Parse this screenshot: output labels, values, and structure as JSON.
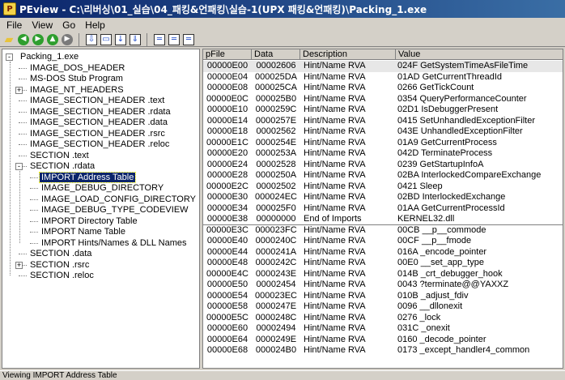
{
  "window": {
    "title": "PEview - C:\\리버싱\\01_실습\\04_패킹&언패킹\\실습-1(UPX 패킹&언패킹)\\Packing_1.exe"
  },
  "menu": [
    "File",
    "View",
    "Go",
    "Help"
  ],
  "tree": [
    {
      "label": "Packing_1.exe",
      "level": 0,
      "expander": "-"
    },
    {
      "label": "IMAGE_DOS_HEADER",
      "level": 1
    },
    {
      "label": "MS-DOS Stub Program",
      "level": 1
    },
    {
      "label": "IMAGE_NT_HEADERS",
      "level": 1,
      "expander": "+"
    },
    {
      "label": "IMAGE_SECTION_HEADER .text",
      "level": 1
    },
    {
      "label": "IMAGE_SECTION_HEADER .rdata",
      "level": 1
    },
    {
      "label": "IMAGE_SECTION_HEADER .data",
      "level": 1
    },
    {
      "label": "IMAGE_SECTION_HEADER .rsrc",
      "level": 1
    },
    {
      "label": "IMAGE_SECTION_HEADER .reloc",
      "level": 1
    },
    {
      "label": "SECTION .text",
      "level": 1
    },
    {
      "label": "SECTION .rdata",
      "level": 1,
      "expander": "-"
    },
    {
      "label": "IMPORT Address Table",
      "level": 2,
      "selected": true
    },
    {
      "label": "IMAGE_DEBUG_DIRECTORY",
      "level": 2
    },
    {
      "label": "IMAGE_LOAD_CONFIG_DIRECTORY",
      "level": 2
    },
    {
      "label": "IMAGE_DEBUG_TYPE_CODEVIEW",
      "level": 2
    },
    {
      "label": "IMPORT Directory Table",
      "level": 2
    },
    {
      "label": "IMPORT Name Table",
      "level": 2
    },
    {
      "label": "IMPORT Hints/Names & DLL Names",
      "level": 2
    },
    {
      "label": "SECTION .data",
      "level": 1
    },
    {
      "label": "SECTION .rsrc",
      "level": 1,
      "expander": "+"
    },
    {
      "label": "SECTION .reloc",
      "level": 1
    }
  ],
  "columns": [
    "pFile",
    "Data",
    "Description",
    "Value"
  ],
  "rows": [
    [
      "00000E00",
      "00002606",
      "Hint/Name RVA",
      "024F  GetSystemTimeAsFileTime"
    ],
    [
      "00000E04",
      "000025DA",
      "Hint/Name RVA",
      "01AD  GetCurrentThreadId"
    ],
    [
      "00000E08",
      "000025CA",
      "Hint/Name RVA",
      "0266  GetTickCount"
    ],
    [
      "00000E0C",
      "000025B0",
      "Hint/Name RVA",
      "0354  QueryPerformanceCounter"
    ],
    [
      "00000E10",
      "0000259C",
      "Hint/Name RVA",
      "02D1  IsDebuggerPresent"
    ],
    [
      "00000E14",
      "0000257E",
      "Hint/Name RVA",
      "0415  SetUnhandledExceptionFilter"
    ],
    [
      "00000E18",
      "00002562",
      "Hint/Name RVA",
      "043E  UnhandledExceptionFilter"
    ],
    [
      "00000E1C",
      "0000254E",
      "Hint/Name RVA",
      "01A9  GetCurrentProcess"
    ],
    [
      "00000E20",
      "0000253A",
      "Hint/Name RVA",
      "042D  TerminateProcess"
    ],
    [
      "00000E24",
      "00002528",
      "Hint/Name RVA",
      "0239  GetStartupInfoA"
    ],
    [
      "00000E28",
      "0000250A",
      "Hint/Name RVA",
      "02BA  InterlockedCompareExchange"
    ],
    [
      "00000E2C",
      "00002502",
      "Hint/Name RVA",
      "0421  Sleep"
    ],
    [
      "00000E30",
      "000024EC",
      "Hint/Name RVA",
      "02BD  InterlockedExchange"
    ],
    [
      "00000E34",
      "000025F0",
      "Hint/Name RVA",
      "01AA  GetCurrentProcessId"
    ],
    [
      "00000E38",
      "00000000",
      "End of Imports",
      "KERNEL32.dll"
    ],
    [
      "00000E3C",
      "000023FC",
      "Hint/Name RVA",
      "00CB  __p__commode"
    ],
    [
      "00000E40",
      "0000240C",
      "Hint/Name RVA",
      "00CF  __p__fmode"
    ],
    [
      "00000E44",
      "0000241A",
      "Hint/Name RVA",
      "016A  _encode_pointer"
    ],
    [
      "00000E48",
      "0000242C",
      "Hint/Name RVA",
      "00E0  __set_app_type"
    ],
    [
      "00000E4C",
      "0000243E",
      "Hint/Name RVA",
      "014B  _crt_debugger_hook"
    ],
    [
      "00000E50",
      "00002454",
      "Hint/Name RVA",
      "0043  ?terminate@@YAXXZ"
    ],
    [
      "00000E54",
      "000023EC",
      "Hint/Name RVA",
      "010B  _adjust_fdiv"
    ],
    [
      "00000E58",
      "0000247E",
      "Hint/Name RVA",
      "0096  __dllonexit"
    ],
    [
      "00000E5C",
      "0000248C",
      "Hint/Name RVA",
      "0276  _lock"
    ],
    [
      "00000E60",
      "00002494",
      "Hint/Name RVA",
      "031C  _onexit"
    ],
    [
      "00000E64",
      "0000249E",
      "Hint/Name RVA",
      "0160  _decode_pointer"
    ],
    [
      "00000E68",
      "000024B0",
      "Hint/Name RVA",
      "0173  _except_handler4_common"
    ]
  ],
  "status": "Viewing IMPORT Address Table",
  "toolbar_icons": [
    {
      "name": "open-folder-icon",
      "glyph": "▰",
      "color": "#e8c33a"
    },
    {
      "name": "back-icon",
      "glyph": "◀",
      "color": "#2e9e2e"
    },
    {
      "name": "forward-icon",
      "glyph": "▶",
      "color": "#2e9e2e"
    },
    {
      "name": "up-icon",
      "glyph": "▲",
      "color": "#2e9e2e"
    },
    {
      "name": "next-icon",
      "glyph": "▶",
      "color": "#7a7a7a"
    },
    {
      "name": "sep"
    },
    {
      "name": "expand-down-icon",
      "glyph": "⇩",
      "color": "#1f4cc8"
    },
    {
      "name": "collapse-icon",
      "glyph": "▭",
      "color": "#1f4cc8"
    },
    {
      "name": "goto-icon",
      "glyph": "↓",
      "color": "#1f4cc8"
    },
    {
      "name": "goto-end-icon",
      "glyph": "⇓",
      "color": "#1f4cc8"
    },
    {
      "name": "sep"
    },
    {
      "name": "view-bytes-icon",
      "glyph": "═",
      "color": "#1f4cc8"
    },
    {
      "name": "view-words-icon",
      "glyph": "═",
      "color": "#1f4cc8"
    },
    {
      "name": "view-dwords-icon",
      "glyph": "═",
      "color": "#1f4cc8"
    }
  ]
}
